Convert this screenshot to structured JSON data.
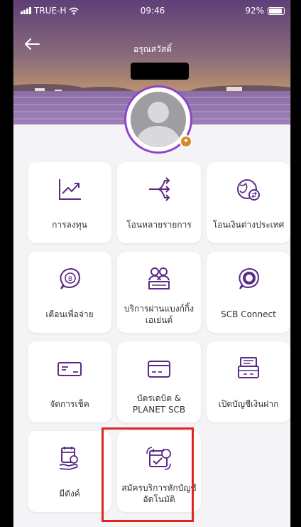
{
  "status_bar": {
    "carrier": "TRUE-H",
    "time": "09:46",
    "battery": "92%"
  },
  "header": {
    "greeting": "อรุณสวัสดิ์"
  },
  "menu": [
    {
      "label": "การลงทุน",
      "icon": "investment-chart-icon"
    },
    {
      "label": "โอนหลายรายการ",
      "icon": "multi-transfer-icon"
    },
    {
      "label": "โอนเงินต่างประเทศ",
      "icon": "international-transfer-icon"
    },
    {
      "label": "เตือนเพื่อจ่าย",
      "icon": "payment-reminder-icon"
    },
    {
      "label": "บริการผ่านแบงก์กิ้งเอเย่นต์",
      "icon": "banking-agent-icon"
    },
    {
      "label": "SCB Connect",
      "icon": "scb-connect-icon"
    },
    {
      "label": "จัดการเช็ค",
      "icon": "cheque-icon"
    },
    {
      "label": "บัตรเดบิต & PLANET SCB",
      "icon": "debit-card-icon"
    },
    {
      "label": "เปิดบัญชีเงินฝาก",
      "icon": "open-account-icon"
    },
    {
      "label": "มีตังค์",
      "icon": "mee-tang-icon"
    },
    {
      "label": "สมัครบริการหักบัญชีอัตโนมัติ",
      "icon": "auto-debit-icon"
    }
  ],
  "colors": {
    "accent": "#5b2a86",
    "highlight": "#e02424",
    "avatar_border": "#8e44c9"
  }
}
